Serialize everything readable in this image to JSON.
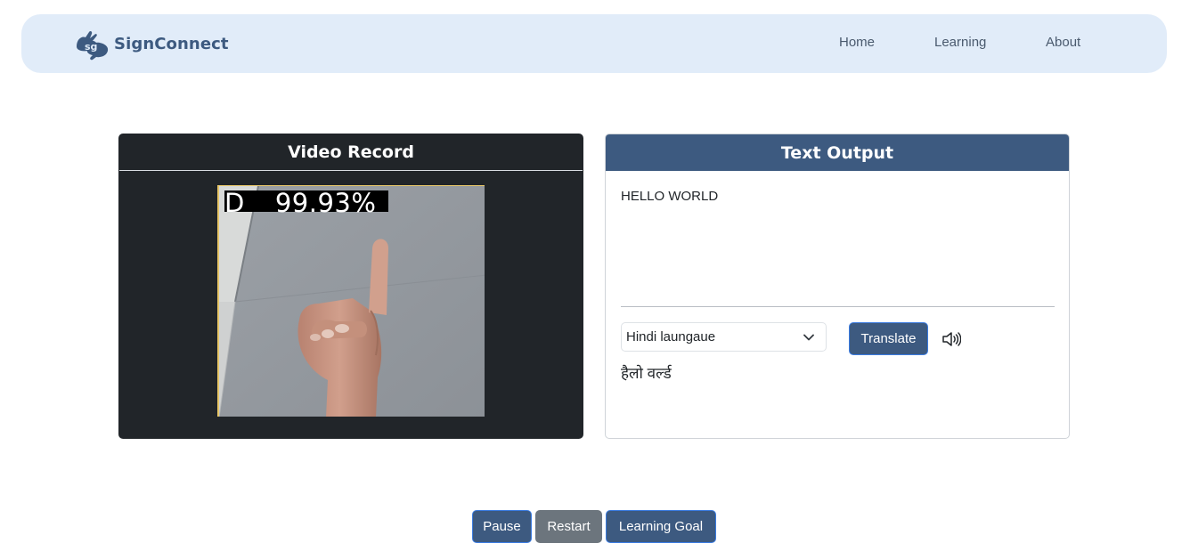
{
  "navbar": {
    "brand_name": "SignConnect",
    "links": [
      "Home",
      "Learning",
      "About"
    ],
    "background": "#e1ecf9",
    "brand_color": "#3d5a80"
  },
  "video_card": {
    "title": "Video Record",
    "prediction_letter": "D",
    "prediction_confidence": "99.93%"
  },
  "output_card": {
    "title": "Text Output",
    "recognized_text": "HELLO WORLD",
    "language_select": {
      "selected": "Hindi laungaue"
    },
    "translate_label": "Translate",
    "speaker_icon": "speaker-icon",
    "translated_text": "हैलो वर्ल्ड",
    "header_color": "#3d5a80"
  },
  "controls": {
    "pause_label": "Pause",
    "restart_label": "Restart",
    "learning_goal_label": "Learning Goal"
  }
}
